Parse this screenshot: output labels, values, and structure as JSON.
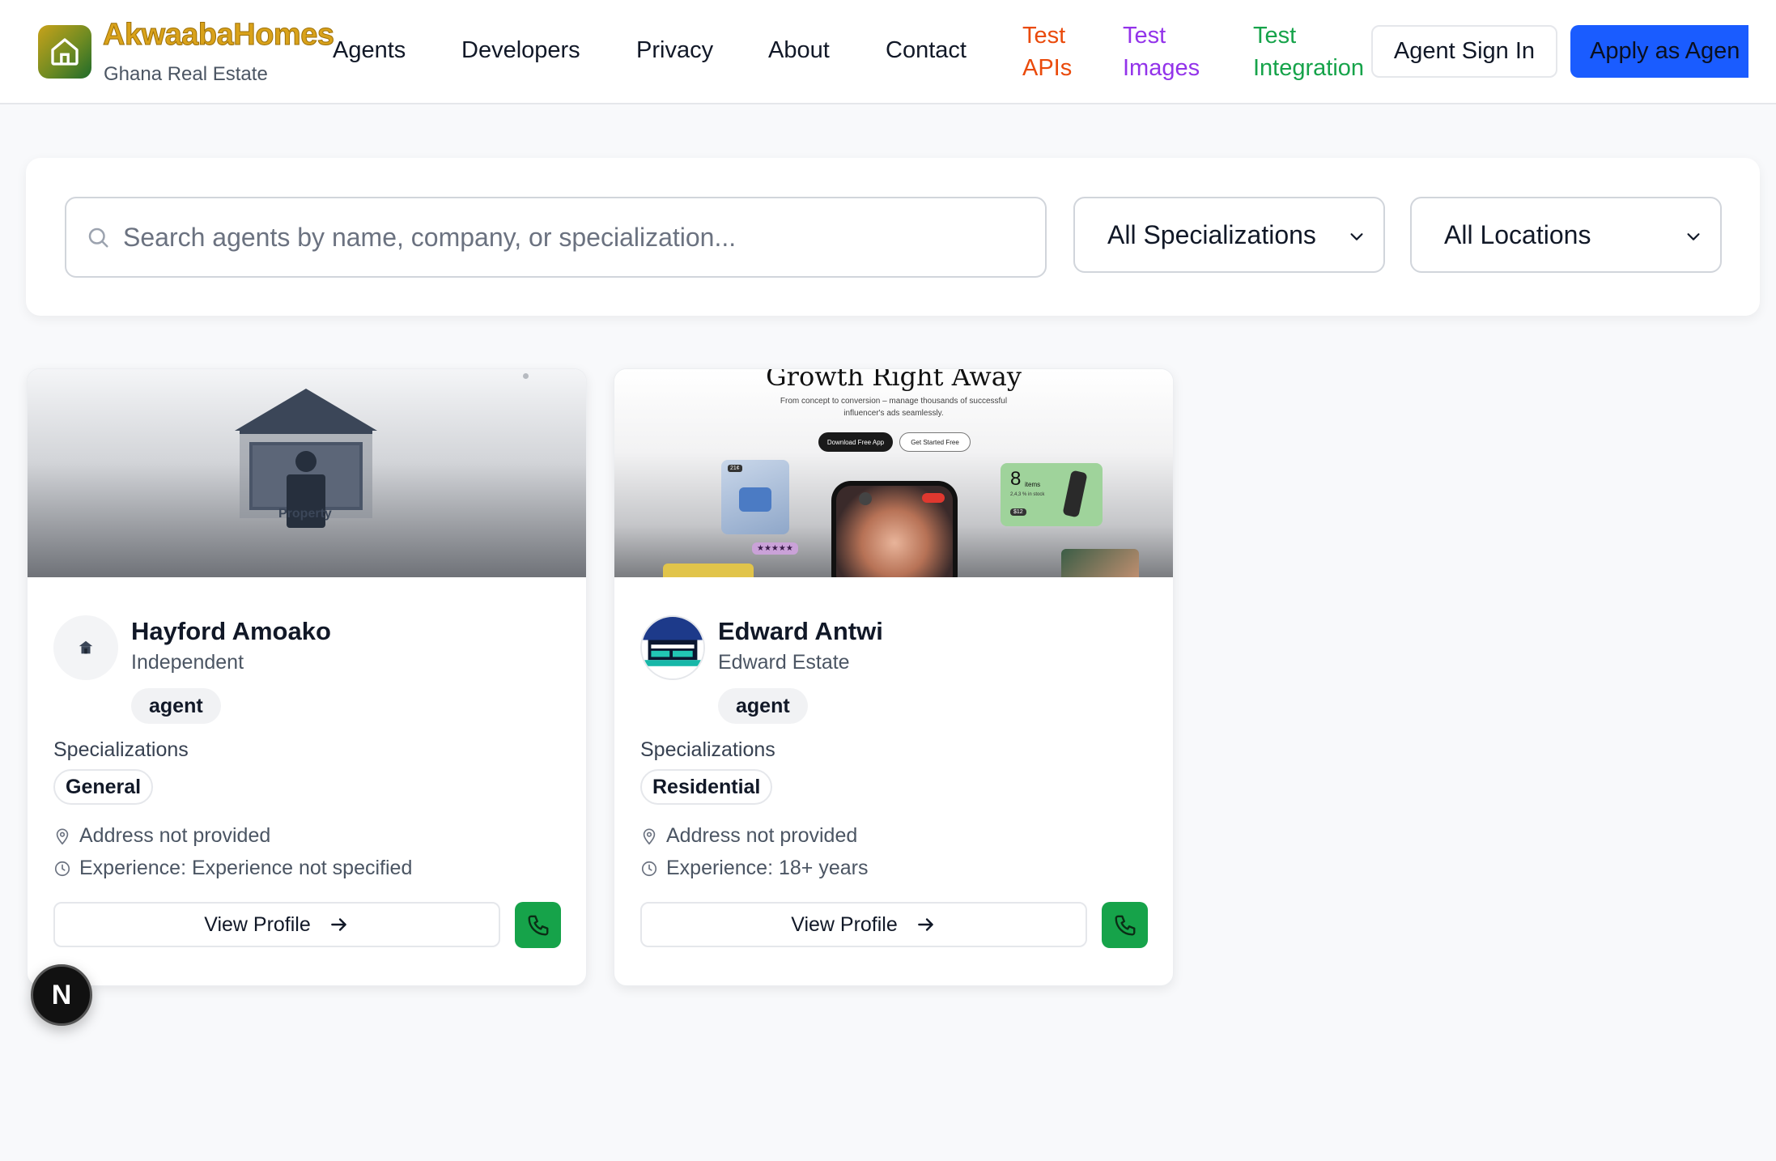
{
  "brand": {
    "name": "AkwaabaHomes",
    "tagline": "Ghana Real Estate",
    "logo_icon": "home-icon"
  },
  "nav": {
    "links": [
      "Agents",
      "Developers",
      "Privacy",
      "About",
      "Contact"
    ],
    "test_links": [
      {
        "line1": "Test",
        "line2": "APIs",
        "color": "#ea4a0b"
      },
      {
        "line1": "Test",
        "line2": "Images",
        "color": "#9333ea"
      },
      {
        "line1": "Test",
        "line2": "Integration",
        "color": "#16a34a"
      }
    ],
    "sign_in": "Agent Sign In",
    "apply": "Apply as Agen"
  },
  "filters": {
    "search_placeholder": "Search agents by name, company, or specialization...",
    "specialization": "All Specializations",
    "location": "All Locations"
  },
  "preview_image": {
    "headline": "Growth Right Away",
    "subtext_line1": "From concept to conversion – manage thousands of successful",
    "subtext_line2": "influencer's ads seamlessly.",
    "btn_primary": "Download Free App",
    "btn_secondary": "Get Started Free",
    "items_count": "8",
    "items_label": "items",
    "items_sub": "2,4,3 % in stock",
    "items_tag": "$12",
    "stars": "★★★★★",
    "badge_mini": "21¢"
  },
  "placeholder_image": {
    "label": "Property"
  },
  "agents": [
    {
      "name": "Hayford Amoako",
      "company": "Independent",
      "role": "agent",
      "specializations_label": "Specializations",
      "specialization": "General",
      "address": "Address not provided",
      "experience": "Experience: Experience not specified",
      "view_profile": "View Profile"
    },
    {
      "name": "Edward Antwi",
      "company": "Edward Estate",
      "role": "agent",
      "specializations_label": "Specializations",
      "specialization": "Residential",
      "address": "Address not provided",
      "experience": "Experience: 18+ years",
      "view_profile": "View Profile"
    }
  ],
  "dev_badge": "N",
  "colors": {
    "primary": "#1a5cff",
    "call": "#16a34a",
    "brand_gold": "#d9a21a"
  }
}
